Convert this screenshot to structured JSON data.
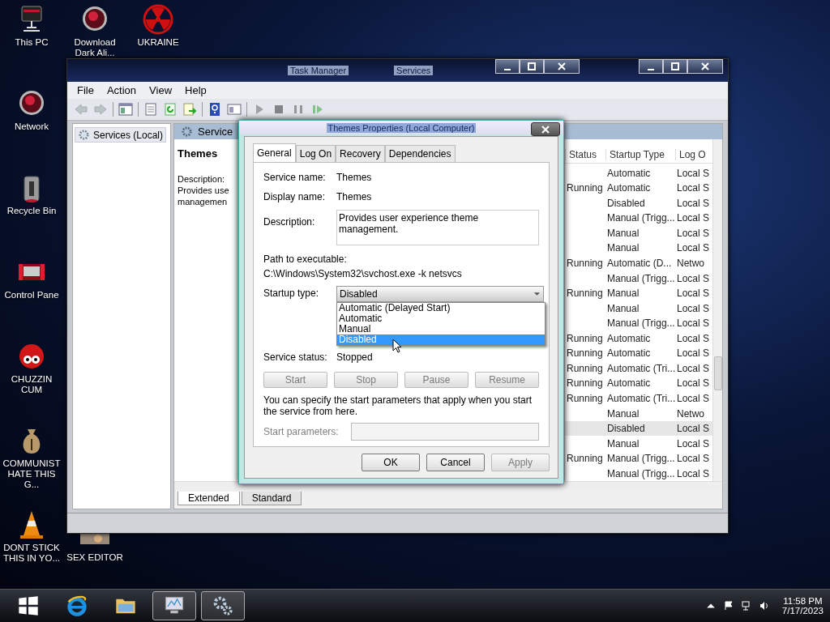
{
  "desktop_icons": [
    {
      "label": "This PC",
      "kind": "pc"
    },
    {
      "label": "Download Dark Ali...",
      "kind": "orb"
    },
    {
      "label": "UKRAINE",
      "kind": "radiation"
    },
    {
      "label": "Network",
      "kind": "orb"
    },
    {
      "label": "Recycle Bin",
      "kind": "bin"
    },
    {
      "label": "Control Pane",
      "kind": "panel"
    },
    {
      "label": "CHUZZIN CUM",
      "kind": "fuzzball"
    },
    {
      "label": "COMMUNIST HATE THIS G...",
      "kind": "moneybag"
    },
    {
      "label": "DONT STICK THIS IN YO...",
      "kind": "cone"
    },
    {
      "label": "SEX EDITOR",
      "kind": "thumb"
    }
  ],
  "services_window": {
    "titles": [
      "Task Manager",
      "Services"
    ],
    "menu": [
      "File",
      "Action",
      "View",
      "Help"
    ],
    "toolbar": [
      [
        {
          "kind": "back",
          "disabled": true
        },
        {
          "kind": "forward",
          "disabled": true
        }
      ],
      [
        {
          "kind": "tree",
          "disabled": false
        }
      ],
      [
        {
          "kind": "props",
          "disabled": false
        },
        {
          "kind": "refresh",
          "disabled": false
        },
        {
          "kind": "export",
          "disabled": false
        }
      ],
      [
        {
          "kind": "help",
          "disabled": false
        },
        {
          "kind": "view",
          "disabled": false
        }
      ],
      [
        {
          "kind": "play",
          "disabled": true
        },
        {
          "kind": "stop",
          "disabled": true
        },
        {
          "kind": "pause",
          "disabled": true
        },
        {
          "kind": "restart",
          "disabled": true
        }
      ]
    ],
    "tree_item": "Services (Local)",
    "pane_header": "Service",
    "detail": {
      "title": "Themes",
      "lines": [
        "Description:",
        "Provides use",
        "managemen"
      ]
    },
    "table": {
      "columns": [
        "Status",
        "Startup Type",
        "Log O"
      ],
      "rows": [
        {
          "status": "",
          "startup_type": "Automatic",
          "log_on": "Local S",
          "selected": false
        },
        {
          "status": "Running",
          "startup_type": "Automatic",
          "log_on": "Local S",
          "selected": false
        },
        {
          "status": "",
          "startup_type": "Disabled",
          "log_on": "Local S",
          "selected": false
        },
        {
          "status": "",
          "startup_type": "Manual (Trigg...",
          "log_on": "Local S",
          "selected": false
        },
        {
          "status": "",
          "startup_type": "Manual",
          "log_on": "Local S",
          "selected": false
        },
        {
          "status": "",
          "startup_type": "Manual",
          "log_on": "Local S",
          "selected": false
        },
        {
          "status": "Running",
          "startup_type": "Automatic (D...",
          "log_on": "Netwo",
          "selected": false
        },
        {
          "status": "",
          "startup_type": "Manual (Trigg...",
          "log_on": "Local S",
          "selected": false
        },
        {
          "status": "Running",
          "startup_type": "Manual",
          "log_on": "Local S",
          "selected": false
        },
        {
          "status": "",
          "startup_type": "Manual",
          "log_on": "Local S",
          "selected": false
        },
        {
          "status": "",
          "startup_type": "Manual (Trigg...",
          "log_on": "Local S",
          "selected": false
        },
        {
          "status": "Running",
          "startup_type": "Automatic",
          "log_on": "Local S",
          "selected": false
        },
        {
          "status": "Running",
          "startup_type": "Automatic",
          "log_on": "Local S",
          "selected": false
        },
        {
          "status": "Running",
          "startup_type": "Automatic (Tri...",
          "log_on": "Local S",
          "selected": false
        },
        {
          "status": "Running",
          "startup_type": "Automatic",
          "log_on": "Local S",
          "selected": false
        },
        {
          "status": "Running",
          "startup_type": "Automatic (Tri...",
          "log_on": "Local S",
          "selected": false
        },
        {
          "status": "",
          "startup_type": "Manual",
          "log_on": "Netwo",
          "selected": false
        },
        {
          "status": "",
          "startup_type": "Disabled",
          "log_on": "Local S",
          "selected": true
        },
        {
          "status": "",
          "startup_type": "Manual",
          "log_on": "Local S",
          "selected": false
        },
        {
          "status": "Running",
          "startup_type": "Manual (Trigg...",
          "log_on": "Local S",
          "selected": false
        },
        {
          "status": "",
          "startup_type": "Manual (Trigg...",
          "log_on": "Local S",
          "selected": false
        }
      ]
    },
    "view_tabs": [
      {
        "label": "Extended",
        "selected": true
      },
      {
        "label": "Standard",
        "selected": false
      }
    ]
  },
  "dialog": {
    "title": "Themes Properties (Local Computer)",
    "tabs": [
      {
        "label": "General",
        "selected": true
      },
      {
        "label": "Log On",
        "selected": false
      },
      {
        "label": "Recovery",
        "selected": false
      },
      {
        "label": "Dependencies",
        "selected": false
      }
    ],
    "fields": [
      {
        "label": "Service name:",
        "value": "Themes"
      },
      {
        "label": "Display name:",
        "value": "Themes"
      }
    ],
    "description": {
      "label": "Description:",
      "value": "Provides user experience theme management."
    },
    "path_label": "Path to executable:",
    "path": "C:\\Windows\\System32\\svchost.exe -k netsvcs",
    "startup": {
      "label": "Startup type:",
      "value": "Disabled",
      "expanded": true,
      "options": [
        {
          "label": "Automatic (Delayed Start)",
          "selected": false
        },
        {
          "label": "Automatic",
          "selected": false
        },
        {
          "label": "Manual",
          "selected": false
        },
        {
          "label": "Disabled",
          "selected": true
        }
      ]
    },
    "status": {
      "label": "Service status:",
      "value": "Stopped"
    },
    "service_buttons": [
      {
        "label": "Start",
        "disabled": true
      },
      {
        "label": "Stop",
        "disabled": true
      },
      {
        "label": "Pause",
        "disabled": true
      },
      {
        "label": "Resume",
        "disabled": true
      }
    ],
    "help_text": "You can specify the start parameters that apply when you start the service from here.",
    "start_params": {
      "label": "Start parameters:",
      "disabled": true
    },
    "buttons": [
      {
        "label": "OK",
        "disabled": false
      },
      {
        "label": "Cancel",
        "disabled": false
      },
      {
        "label": "Apply",
        "disabled": true
      }
    ]
  },
  "taskbar": {
    "items": [
      {
        "kind": "start",
        "running": false
      },
      {
        "kind": "browser",
        "running": false
      },
      {
        "kind": "folder",
        "running": false
      },
      {
        "kind": "monitor",
        "running": true
      },
      {
        "kind": "gears",
        "running": true
      }
    ],
    "time": "11:58 PM",
    "date": "7/17/2023"
  }
}
